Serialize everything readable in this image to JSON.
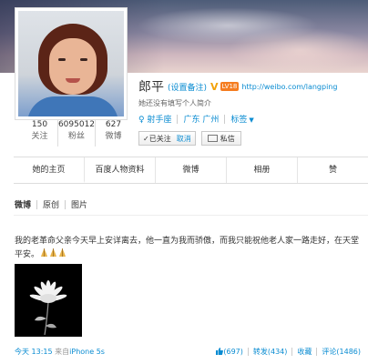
{
  "profile": {
    "name": "郎平",
    "remark": "(设置备注)",
    "verified_badge": "V",
    "level_badge": "LV18",
    "homepage": "http://weibo.com/langping",
    "bio": "她还没有填写个人简介",
    "zodiac": "射手座",
    "location": "广东 广州",
    "tags_label": "标签",
    "followed_label": "✓已关注",
    "cancel_label": "取消",
    "message_label": "私信"
  },
  "stats": [
    {
      "value": "150",
      "label": "关注"
    },
    {
      "value": "6095012",
      "label": "粉丝"
    },
    {
      "value": "627",
      "label": "微博"
    }
  ],
  "tabs": [
    "她的主页",
    "百度人物资料",
    "微博",
    "相册",
    "赞"
  ],
  "subtabs": [
    "微博",
    "原创",
    "图片"
  ],
  "post": {
    "text": "我的老革命父亲今天早上安详离去，他一直为我而骄傲，而我只能祝他老人家一路走好，在天堂平安。",
    "emoji_icons": [
      "pray-icon",
      "pray-icon",
      "pray-icon"
    ],
    "image": "white-chrysanthemum-icon",
    "time": "今天",
    "clock": "13:15",
    "source_prefix": "来自",
    "source": "iPhone 5s",
    "likes": "(697)",
    "reposts": "转发(434)",
    "favorite": "收藏",
    "comments": "评论(1486)"
  },
  "colors": {
    "link": "#0a8cd2",
    "badge_orange": "#f57c1f",
    "verified_gold": "#f2a20b"
  }
}
